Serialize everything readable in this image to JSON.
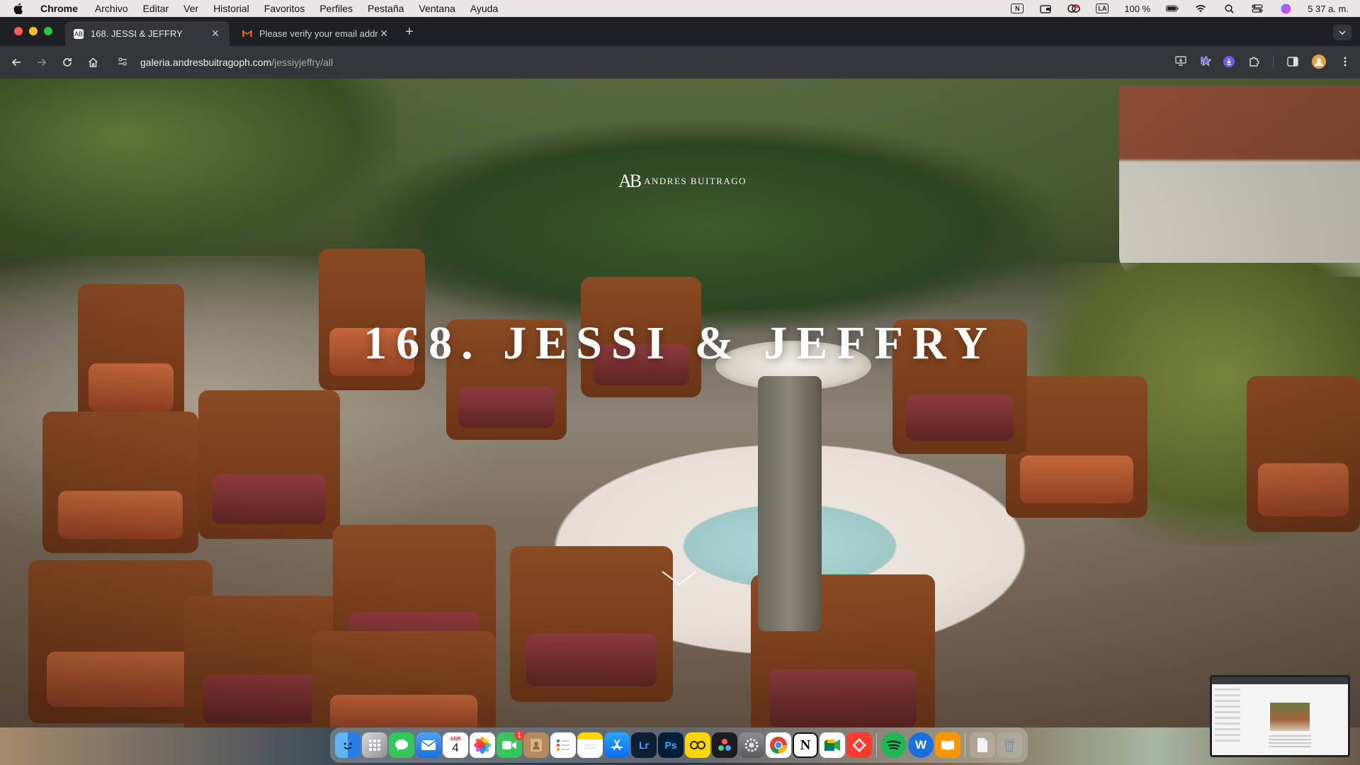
{
  "menubar": {
    "app_name": "Chrome",
    "menus": [
      "Archivo",
      "Editar",
      "Ver",
      "Historial",
      "Favoritos",
      "Perfiles",
      "Pestaña",
      "Ventana",
      "Ayuda"
    ],
    "status": {
      "notion_glyph": "N",
      "keyboard_layout": "LA",
      "battery": "100 %",
      "clock": "5 37 a. m."
    }
  },
  "browser": {
    "tabs": [
      {
        "title": "168. JESSI & JEFFRY",
        "favicon": "AB",
        "close": "✕",
        "active": true
      },
      {
        "title": "Please verify your email address",
        "favicon": "M",
        "close": "✕",
        "active": false
      }
    ],
    "new_tab": "+",
    "url_host": "galeria.andresbuitragoph.com",
    "url_path": "/jessiyjeffry/all"
  },
  "page": {
    "brand_monogram": "AB",
    "brand_name": "ANDRES BUITRAGO",
    "title": "168. JESSI & JEFFRY"
  },
  "dock": {
    "calendar_day": "4",
    "calendar_month": "ABR",
    "facetime_badge": "1",
    "lightroom": "Lr",
    "photoshop": "Ps",
    "notion": "N",
    "word_w": "W"
  },
  "colors": {
    "menubar_bg": "#e9e6e4",
    "tabstrip_bg": "#1f2023",
    "toolbar_bg": "#35363a",
    "title_color": "#ffffff"
  }
}
